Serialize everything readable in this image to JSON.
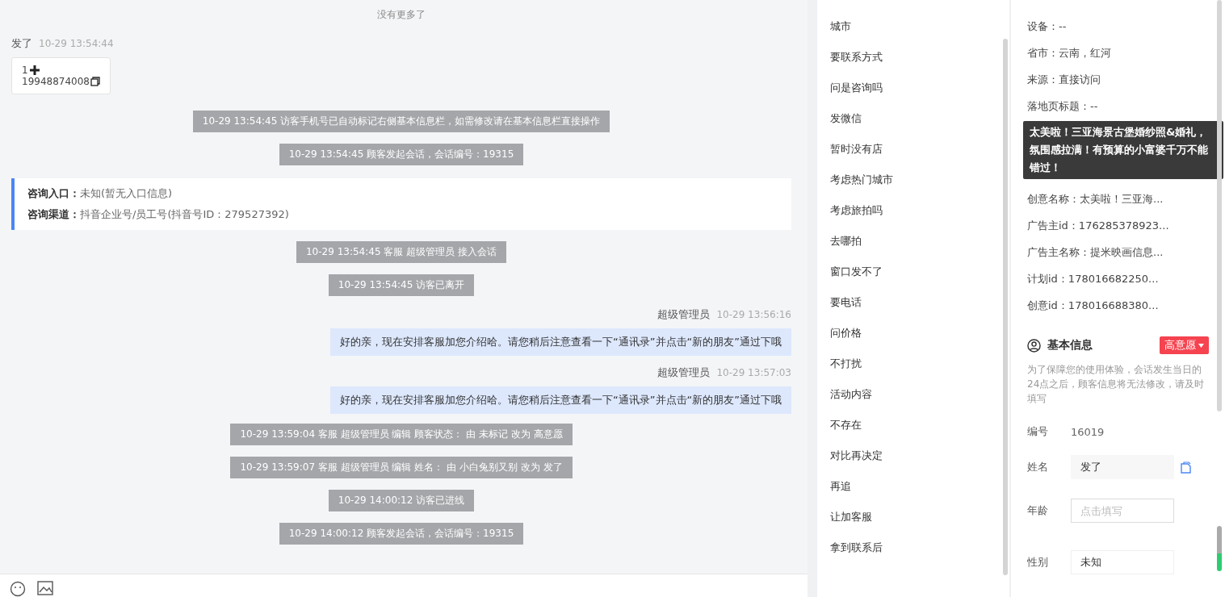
{
  "chat": {
    "no_more": "没有更多了",
    "messages": [
      {
        "kind": "visitor",
        "name": "发了",
        "time": "10-29 13:54:44",
        "line1": "1",
        "phone": "19948874008"
      },
      {
        "kind": "system",
        "text": "10-29 13:54:45 访客手机号已自动标记右侧基本信息栏，如需修改请在基本信息栏直接操作"
      },
      {
        "kind": "system",
        "text": "10-29 13:54:45 顾客发起会话，会话编号：19315"
      },
      {
        "kind": "entry",
        "rows": [
          {
            "label": "咨询入口：",
            "value": "未知(暂无入口信息)"
          },
          {
            "label": "咨询渠道：",
            "value": "抖音企业号/员工号(抖音号ID：279527392)"
          }
        ]
      },
      {
        "kind": "system",
        "text": "10-29 13:54:45 客服 超级管理员 接入会话"
      },
      {
        "kind": "system",
        "text": "10-29 13:54:45 访客已离开"
      },
      {
        "kind": "agent",
        "name": "超级管理员",
        "time": "10-29 13:56:16",
        "text": "好的亲，现在安排客服加您介绍哈。请您稍后注意查看一下“通讯录”并点击“新的朋友”通过下哦"
      },
      {
        "kind": "agent",
        "name": "超级管理员",
        "time": "10-29 13:57:03",
        "text": "好的亲，现在安排客服加您介绍哈。请您稍后注意查看一下“通讯录”并点击“新的朋友”通过下哦"
      },
      {
        "kind": "system",
        "text": "10-29 13:59:04 客服 超级管理员 编辑 顾客状态： 由 未标记 改为 高意愿"
      },
      {
        "kind": "system",
        "text": "10-29 13:59:07 客服 超级管理员 编辑 姓名： 由 小白兔别又别 改为 发了"
      },
      {
        "kind": "system",
        "text": "10-29 14:00:12 访客已进线"
      },
      {
        "kind": "system",
        "text": "10-29 14:00:12 顾客发起会话，会话编号：19315"
      }
    ]
  },
  "quick_replies": [
    "城市",
    "要联系方式",
    "问是咨询吗",
    "发微信",
    "暂时没有店",
    "考虑热门城市",
    "考虑旅拍吗",
    "去哪拍",
    "窗口发不了",
    "要电话",
    "问价格",
    "不打扰",
    "活动内容",
    "不存在",
    "对比再决定",
    "再追",
    "让加客服",
    "拿到联系后"
  ],
  "visitor_info": {
    "lines_top": [
      "设备：--",
      "省市：云南，红河",
      "来源：直接访问",
      "落地页标题：--"
    ],
    "tooltip": "太美啦！三亚海景古堡婚纱照&婚礼，氛围感拉满！有预算的小富婆千万不能错过！",
    "lines_bottom": [
      "创意名称：太美啦！三亚海...",
      "广告主id：176285378923...",
      "广告主名称：提米映画信息...",
      "计划id：178016682250...",
      "创意id：178016688380..."
    ]
  },
  "basic_info": {
    "title": "基本信息",
    "status": {
      "label": "高意愿",
      "color": "#f5434f"
    },
    "notice": "为了保障您的使用体验，会话发生当日的24点之后，顾客信息将无法修改，请及时填写",
    "fields": [
      {
        "kind": "text",
        "label": "编号",
        "value": "16019"
      },
      {
        "kind": "readonly",
        "label": "姓名",
        "value": "发了"
      },
      {
        "kind": "input",
        "label": "年龄",
        "placeholder": "点击填写"
      },
      {
        "kind": "input",
        "label": "性别",
        "value": "未知"
      }
    ]
  }
}
